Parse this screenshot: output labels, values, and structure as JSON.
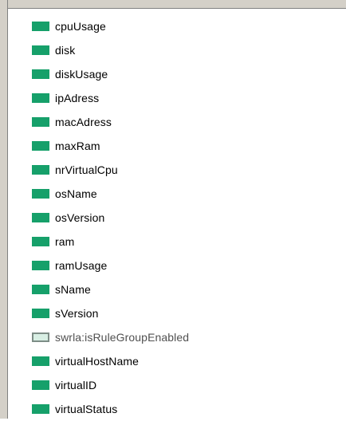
{
  "colors": {
    "property_swatch": "#16a06a",
    "annotation_swatch_fill": "#d8efe4",
    "annotation_swatch_border": "#7d8d86"
  },
  "properties": [
    {
      "label": "cpuUsage",
      "icon": "green-square-icon"
    },
    {
      "label": "disk",
      "icon": "green-square-icon"
    },
    {
      "label": "diskUsage",
      "icon": "green-square-icon"
    },
    {
      "label": "ipAdress",
      "icon": "green-square-icon"
    },
    {
      "label": "macAdress",
      "icon": "green-square-icon"
    },
    {
      "label": "maxRam",
      "icon": "green-square-icon"
    },
    {
      "label": "nrVirtualCpu",
      "icon": "green-square-icon"
    },
    {
      "label": "osName",
      "icon": "green-square-icon"
    },
    {
      "label": "osVersion",
      "icon": "green-square-icon"
    },
    {
      "label": "ram",
      "icon": "green-square-icon"
    },
    {
      "label": "ramUsage",
      "icon": "green-square-icon"
    },
    {
      "label": "sName",
      "icon": "green-square-icon"
    },
    {
      "label": "sVersion",
      "icon": "green-square-icon"
    },
    {
      "label": "swrla:isRuleGroupEnabled",
      "icon": "outlined-square-icon"
    },
    {
      "label": "virtualHostName",
      "icon": "green-square-icon"
    },
    {
      "label": "virtualID",
      "icon": "green-square-icon"
    },
    {
      "label": "virtualStatus",
      "icon": "green-square-icon"
    }
  ]
}
